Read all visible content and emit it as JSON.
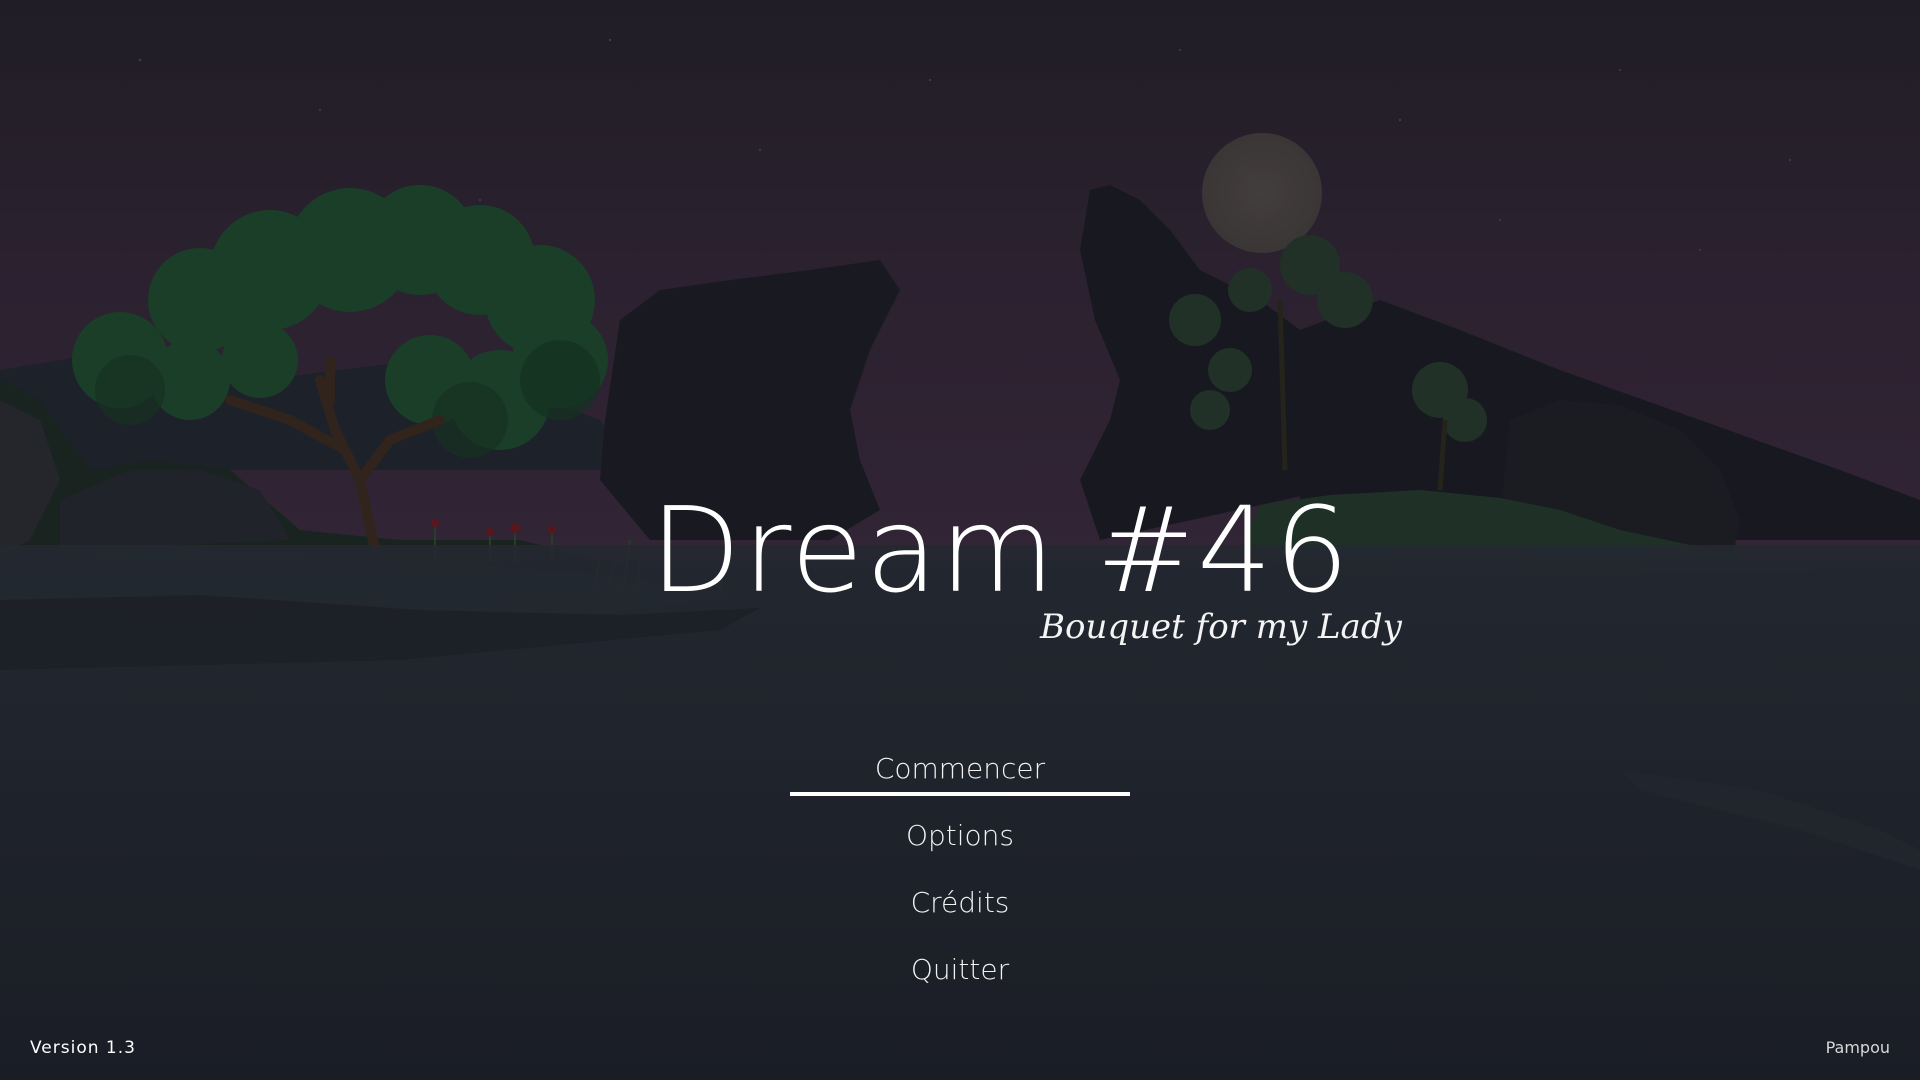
{
  "game": {
    "title": "Dream #46",
    "subtitle": "Bouquet for my Lady"
  },
  "menu": {
    "selected_index": 0,
    "items": [
      {
        "label": "Commencer"
      },
      {
        "label": "Options"
      },
      {
        "label": "Crédits"
      },
      {
        "label": "Quitter"
      }
    ]
  },
  "footer": {
    "version": "Version 1.3",
    "author": "Pampou"
  },
  "colors": {
    "sky_top": "#2a2330",
    "sky_bottom": "#3a2a3d",
    "water": "#232831",
    "rock": "#1c1d24",
    "foliage": "#1f4a2f",
    "moon": "#4a4845",
    "text": "#ffffff"
  }
}
